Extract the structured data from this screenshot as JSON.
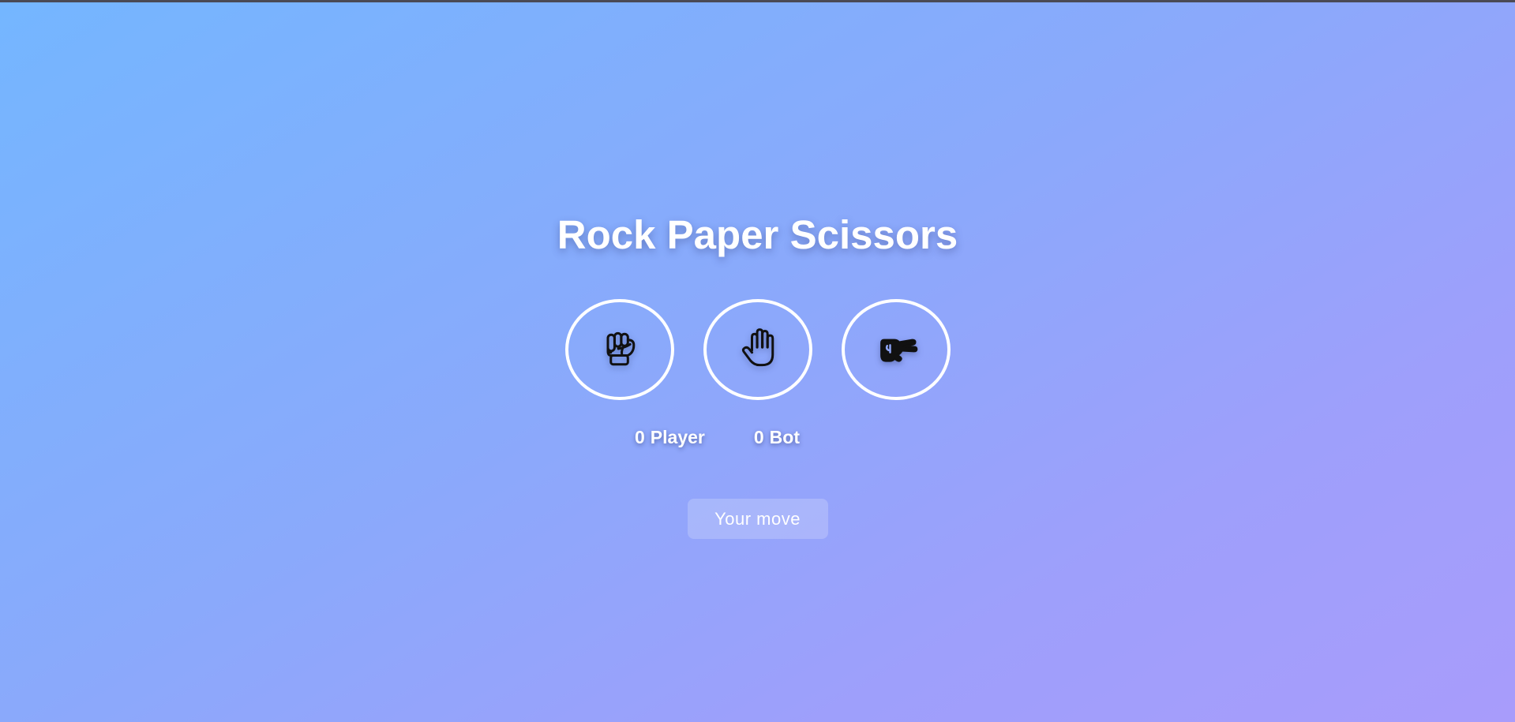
{
  "game": {
    "title": "Rock Paper Scissors",
    "choices": [
      {
        "id": "rock",
        "icon": "fist-icon"
      },
      {
        "id": "paper",
        "icon": "open-hand-icon"
      },
      {
        "id": "scissors",
        "icon": "victory-hand-icon"
      }
    ],
    "scores": {
      "player": {
        "value": "0",
        "label": "Player"
      },
      "bot": {
        "value": "0",
        "label": "Bot"
      }
    },
    "status": "Your move"
  },
  "colors": {
    "gradient_start": "#74b6ff",
    "gradient_end": "#a89cfb",
    "foreground": "#ffffff",
    "icon_stroke": "#111111"
  }
}
